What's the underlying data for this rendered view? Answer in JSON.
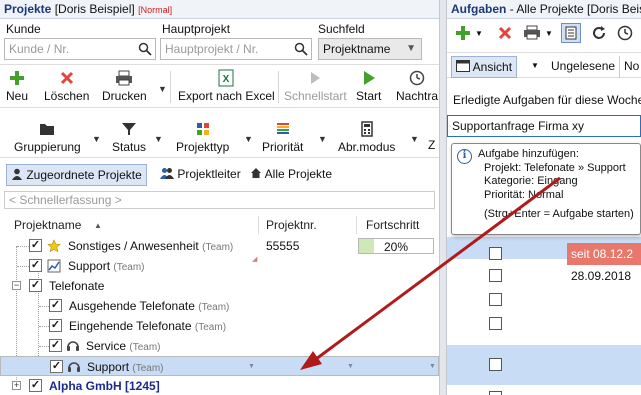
{
  "left": {
    "title": "Projekte",
    "user": "[Doris Beispiel]",
    "mode": "[Normal]",
    "labels": {
      "kunde": "Kunde",
      "hauptprojekt": "Hauptprojekt",
      "suchfeld": "Suchfeld"
    },
    "kunde_placeholder": "Kunde / Nr.",
    "hauptprojekt_placeholder": "Hauptprojekt / Nr.",
    "suchfeld_value": "Projektname",
    "ribbon1": {
      "neu": "Neu",
      "loeschen": "Löschen",
      "drucken": "Drucken",
      "export": "Export nach Excel",
      "schnellstart": "Schnellstart",
      "start": "Start",
      "nachtrag": "Nachtra"
    },
    "ribbon2": {
      "gruppierung": "Gruppierung",
      "status": "Status",
      "projekttyp": "Projekttyp",
      "prioritaet": "Priorität",
      "abrmodus": "Abr.modus",
      "z": "Z"
    },
    "tabs": [
      "Zugeordnete Projekte",
      "Projektleiter",
      "Alle Projekte"
    ],
    "quick_placeholder": "< Schnellerfassung >",
    "columns": {
      "name": "Projektname",
      "nr": "Projektnr.",
      "progress": "Fortschritt"
    },
    "rows": [
      {
        "name": "Sonstiges / Anwesenheit",
        "team": "(Team)",
        "nr": "55555",
        "progress": 0.2,
        "progress_label": "20%"
      },
      {
        "name": "Support",
        "team": "(Team)"
      },
      {
        "name": "Telefonate"
      },
      {
        "name": "Ausgehende Telefonate",
        "team": "(Team)"
      },
      {
        "name": "Eingehende Telefonate",
        "team": "(Team)"
      },
      {
        "name": "Service",
        "team": "(Team)"
      },
      {
        "name": "Support",
        "team": "(Team)"
      },
      {
        "name": "Alpha GmbH [1245]"
      }
    ]
  },
  "right": {
    "title": "Aufgaben",
    "subtitle": "- Alle Projekte [Doris Beispiel]",
    "ansicht": "Ansicht",
    "ungelesene": "Ungelesene",
    "no": "No",
    "done_label": "Erledigte Aufgaben für diese Woche",
    "input_value": "Supportanfrage Firma xy",
    "dates": [
      "seit 08.12.2",
      "28.09.2018"
    ]
  },
  "tooltip": {
    "title": "Aufgabe hinzufügen:",
    "projekt": "Projekt: Telefonate » Support",
    "kategorie": "Kategorie: Eingang",
    "prioritaet": "Priorität: Normal",
    "hint": "(Strg+Enter = Aufgabe starten)"
  },
  "colors": {
    "accent": "#1b3a74",
    "selection": "#c9dcf5",
    "overdue": "#e8776c",
    "arrow": "#b11a1a"
  }
}
